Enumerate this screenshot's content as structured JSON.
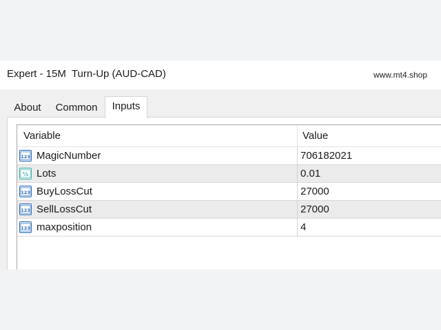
{
  "window": {
    "title": "Expert - 15M  Turn-Up (AUD-CAD)",
    "site": "www.mt4.shop"
  },
  "tabs": [
    {
      "label": "About",
      "active": false
    },
    {
      "label": "Common",
      "active": false
    },
    {
      "label": "Inputs",
      "active": true
    }
  ],
  "table": {
    "columns": [
      "Variable",
      "Value"
    ],
    "rows": [
      {
        "icon": "integer-type-icon",
        "icon_text": "123",
        "variable": "MagicNumber",
        "value": "706182021"
      },
      {
        "icon": "double-type-icon",
        "icon_text": "½",
        "variable": "Lots",
        "value": "0.01"
      },
      {
        "icon": "integer-type-icon",
        "icon_text": "123",
        "variable": "BuyLossCut",
        "value": "27000"
      },
      {
        "icon": "integer-type-icon",
        "icon_text": "123",
        "variable": "SellLossCut",
        "value": "27000"
      },
      {
        "icon": "integer-type-icon",
        "icon_text": "123",
        "variable": "maxposition",
        "value": "4"
      }
    ]
  },
  "colors": {
    "integer_icon": "#2f6fb5",
    "double_icon": "#3fb0a8"
  }
}
